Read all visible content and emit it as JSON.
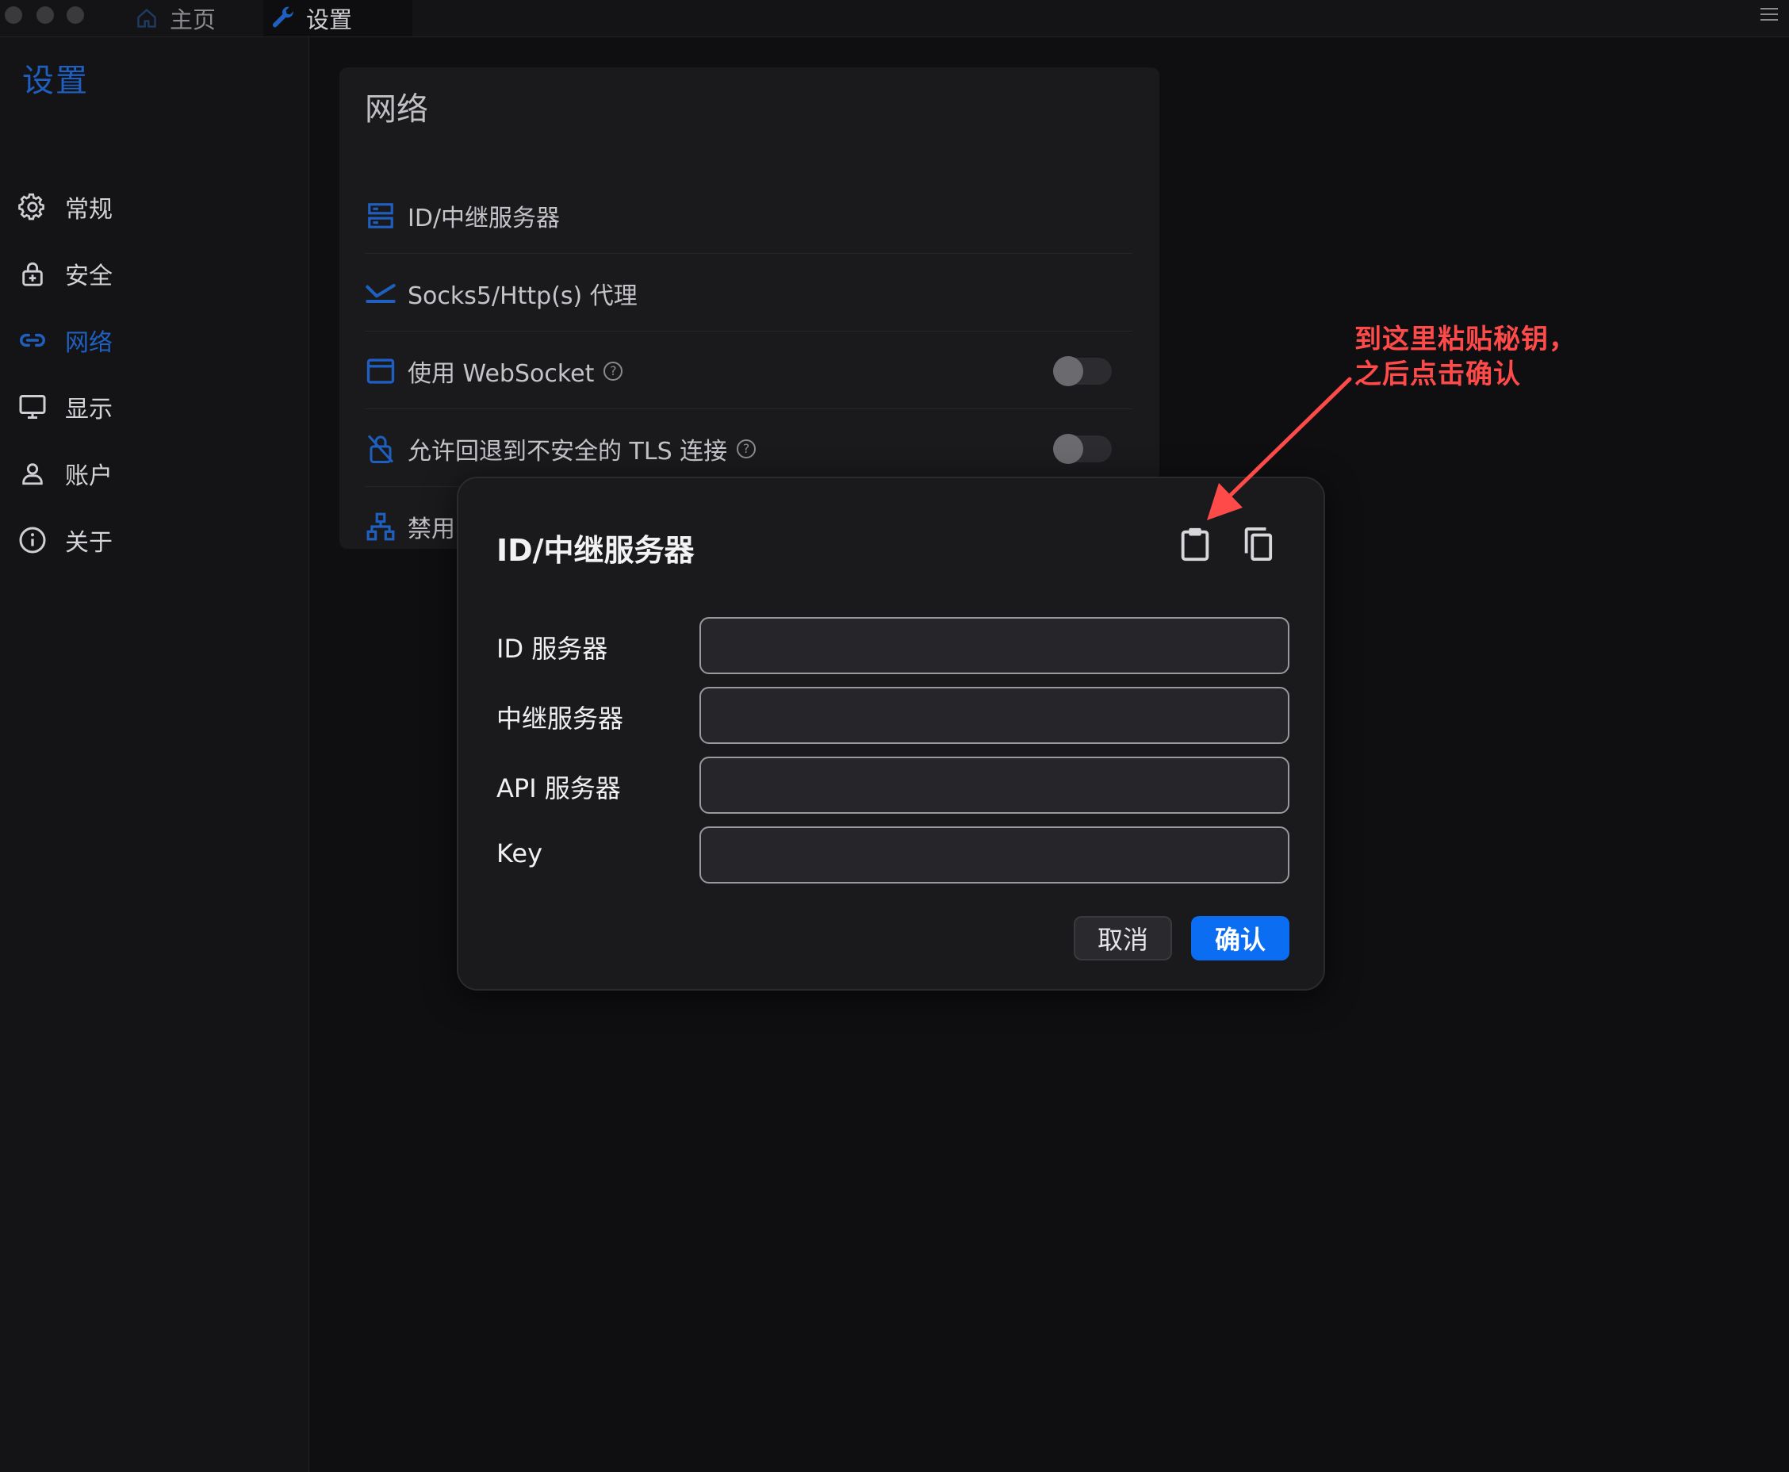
{
  "titlebar": {
    "tabs": [
      {
        "label": "主页",
        "icon": "home-icon"
      },
      {
        "label": "设置",
        "icon": "wrench-icon"
      }
    ]
  },
  "sidebar": {
    "title": "设置",
    "items": [
      {
        "label": "常规",
        "icon": "gear-icon"
      },
      {
        "label": "安全",
        "icon": "lock-icon"
      },
      {
        "label": "网络",
        "icon": "link-icon",
        "active": true
      },
      {
        "label": "显示",
        "icon": "monitor-icon"
      },
      {
        "label": "账户",
        "icon": "user-icon"
      },
      {
        "label": "关于",
        "icon": "info-icon"
      }
    ]
  },
  "network": {
    "title": "网络",
    "rows": [
      {
        "label": "ID/中继服务器",
        "icon": "server-icon"
      },
      {
        "label": "Socks5/Http(s) 代理",
        "icon": "proxy-icon"
      },
      {
        "label": "使用 WebSocket",
        "icon": "window-icon",
        "help": "?",
        "toggle": false
      },
      {
        "label": "允许回退到不安全的 TLS 连接",
        "icon": "unlock-icon",
        "help": "?",
        "toggle": false
      },
      {
        "label": "禁用",
        "icon": "network-icon"
      }
    ]
  },
  "dialog": {
    "title": "ID/中继服务器",
    "fields": [
      {
        "label": "ID 服务器",
        "value": ""
      },
      {
        "label": "中继服务器",
        "value": ""
      },
      {
        "label": "API 服务器",
        "value": ""
      },
      {
        "label": "Key",
        "value": ""
      }
    ],
    "cancel_label": "取消",
    "confirm_label": "确认",
    "paste_icon": "clipboard-paste-icon",
    "copy_icon": "copy-icon"
  },
  "annotation": {
    "line1": "到这里粘贴秘钥，",
    "line2": "之后点击确认"
  },
  "colors": {
    "accent": "#1f5fbf",
    "primary_button": "#0a6df2",
    "annotation": "#ff4a4a"
  }
}
